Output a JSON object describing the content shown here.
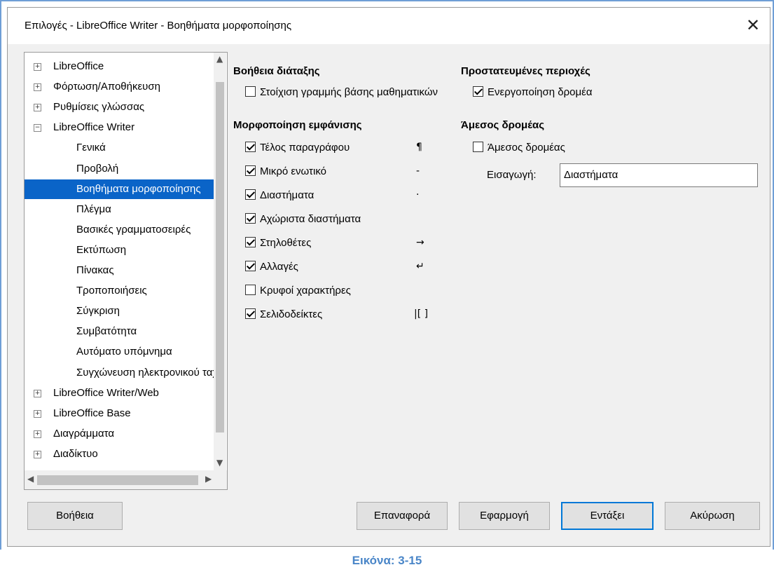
{
  "window": {
    "title": "Επιλογές - LibreOffice Writer - Βοηθήματα μορφοποίησης",
    "close_icon": "close-icon"
  },
  "tree": {
    "items": [
      {
        "label": "LibreOffice",
        "level": 0,
        "expander": "+"
      },
      {
        "label": "Φόρτωση/Αποθήκευση",
        "level": 0,
        "expander": "+"
      },
      {
        "label": "Ρυθμίσεις γλώσσας",
        "level": 0,
        "expander": "+"
      },
      {
        "label": "LibreOffice Writer",
        "level": 0,
        "expander": "−"
      },
      {
        "label": "Γενικά",
        "level": 1
      },
      {
        "label": "Προβολή",
        "level": 1
      },
      {
        "label": "Βοηθήματα μορφοποίησης",
        "level": 1,
        "selected": true
      },
      {
        "label": "Πλέγμα",
        "level": 1
      },
      {
        "label": "Βασικές γραμματοσειρές",
        "level": 1
      },
      {
        "label": "Εκτύπωση",
        "level": 1
      },
      {
        "label": "Πίνακας",
        "level": 1
      },
      {
        "label": "Τροποποιήσεις",
        "level": 1
      },
      {
        "label": "Σύγκριση",
        "level": 1
      },
      {
        "label": "Συμβατότητα",
        "level": 1
      },
      {
        "label": "Αυτόματο υπόμνημα",
        "level": 1
      },
      {
        "label": "Συγχώνευση ηλεκτρονικού ταχυδρομείου",
        "level": 1
      },
      {
        "label": "LibreOffice Writer/Web",
        "level": 0,
        "expander": "+"
      },
      {
        "label": "LibreOffice Base",
        "level": 0,
        "expander": "+"
      },
      {
        "label": "Διαγράμματα",
        "level": 0,
        "expander": "+"
      },
      {
        "label": "Διαδίκτυο",
        "level": 0,
        "expander": "+"
      }
    ]
  },
  "layout_assist": {
    "heading": "Βοήθεια διάταξης",
    "math_baseline": {
      "label": "Στοίχιση γραμμής βάσης μαθηματικών",
      "checked": false
    }
  },
  "protected": {
    "heading": "Προστατευμένες περιοχές",
    "enable_cursor": {
      "label": "Ενεργοποίηση δρομέα",
      "checked": true
    }
  },
  "display_formatting": {
    "heading": "Μορφοποίηση εμφάνισης",
    "items": [
      {
        "label": "Τέλος παραγράφου",
        "checked": true,
        "symbol": "¶"
      },
      {
        "label": "Μικρό ενωτικό",
        "checked": true,
        "symbol": "-"
      },
      {
        "label": "Διαστήματα",
        "checked": true,
        "symbol": "·"
      },
      {
        "label": "Αχώριστα διαστήματα",
        "checked": true,
        "symbol": ""
      },
      {
        "label": "Στηλοθέτες",
        "checked": true,
        "symbol": "→"
      },
      {
        "label": "Αλλαγές",
        "checked": true,
        "symbol": "↵"
      },
      {
        "label": "Κρυφοί χαρακτήρες",
        "checked": false,
        "symbol": ""
      },
      {
        "label": "Σελιδοδείκτες",
        "checked": true,
        "symbol": "|[ ]"
      }
    ]
  },
  "direct_cursor": {
    "heading": "Άμεσος δρομέας",
    "checkbox": {
      "label": "Άμεσος δρομέας",
      "checked": false
    },
    "insert_label": "Εισαγωγή:",
    "insert_value": "Διαστήματα"
  },
  "buttons": {
    "help": "Βοήθεια",
    "reset": "Επαναφορά",
    "apply": "Εφαρμογή",
    "ok": "Εντάξει",
    "cancel": "Ακύρωση"
  },
  "caption": "Εικόνα: 3-15"
}
